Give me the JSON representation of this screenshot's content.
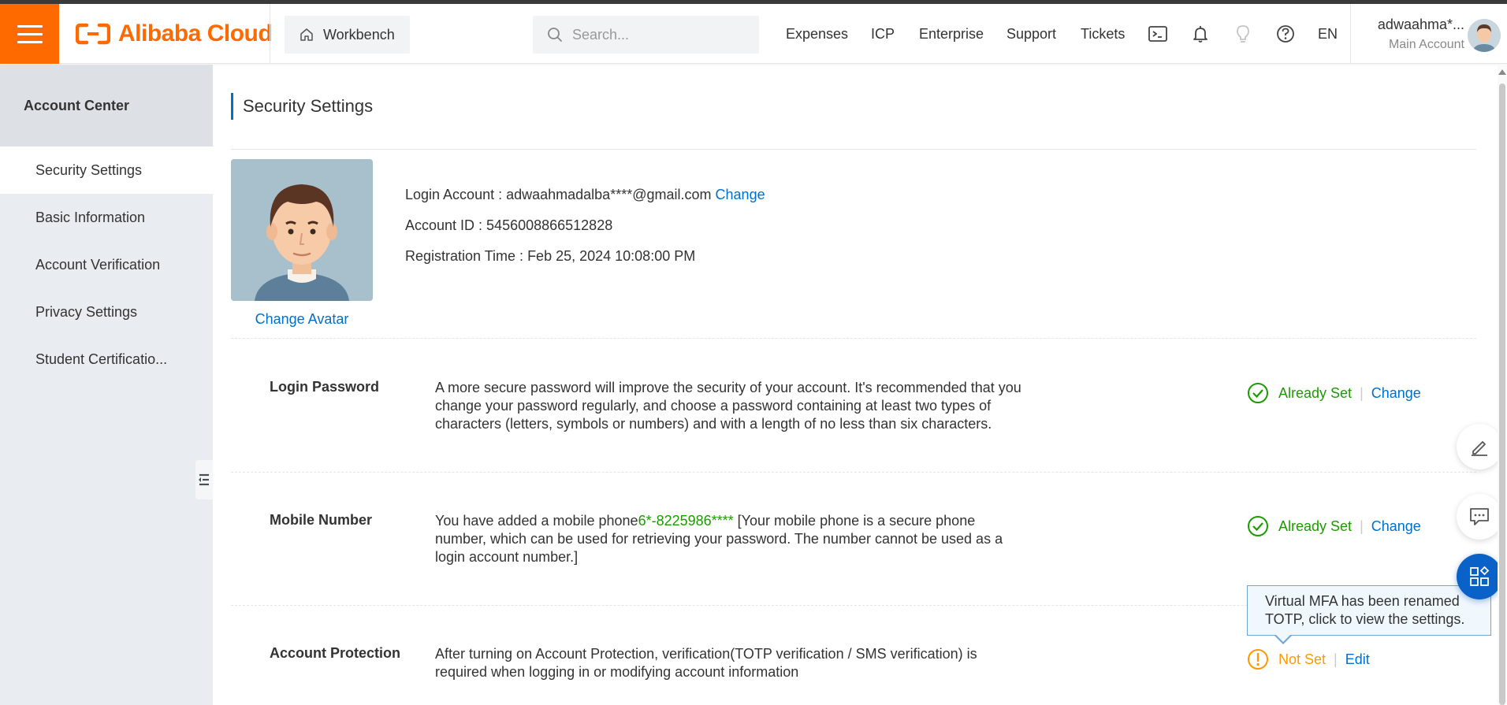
{
  "topbar": {
    "logo_text": "Alibaba Cloud",
    "workbench_label": "Workbench",
    "search_placeholder": "Search...",
    "nav": [
      "Expenses",
      "ICP",
      "Enterprise",
      "Support",
      "Tickets"
    ],
    "lang": "EN",
    "account_name": "adwaahma*...",
    "account_type": "Main Account"
  },
  "sidebar": {
    "title": "Account Center",
    "items": [
      {
        "label": "Security Settings",
        "active": true
      },
      {
        "label": "Basic Information",
        "active": false
      },
      {
        "label": "Account Verification",
        "active": false
      },
      {
        "label": "Privacy Settings",
        "active": false
      },
      {
        "label": "Student Certificatio...",
        "active": false
      }
    ]
  },
  "main": {
    "title": "Security Settings",
    "change_avatar": "Change Avatar",
    "login_account_label": "Login Account : ",
    "login_account_value": "adwaahmadalba****@gmail.com",
    "login_account_change": "Change",
    "account_id_label": "Account ID : ",
    "account_id_value": "5456008866512828",
    "registration_label": "Registration Time : ",
    "registration_value": "Feb 25, 2024 10:08:00 PM",
    "rows": [
      {
        "label": "Login Password",
        "desc": "A more secure password will improve the security of your account. It's recommended that you change your password regularly, and choose a password containing at least two types of characters (letters, symbols or numbers) and with a length of no less than six characters.",
        "status": "Already Set",
        "action": "Change"
      },
      {
        "label": "Mobile Number",
        "desc_prefix": "You have added a mobile phone",
        "desc_phone": "6*-8225986****",
        "desc_suffix": " [Your mobile phone is a secure phone number, which can be used for retrieving your password. The number cannot be used as a login account number.]",
        "status": "Already Set",
        "action": "Change"
      },
      {
        "label": "Account Protection",
        "desc": "After turning on Account Protection, verification(TOTP verification / SMS verification) is required when logging in or modifying account information",
        "status": "Not Set",
        "action": "Edit"
      }
    ],
    "tooltip": "Virtual MFA has been renamed TOTP, click to view the settings."
  },
  "colors": {
    "brand": "#ff6a00",
    "link": "#0070cc",
    "ok": "#1c9b00",
    "warn": "#ff9900"
  },
  "icons": [
    "menu-icon",
    "alibaba-logo-icon",
    "home-icon",
    "search-icon",
    "terminal-icon",
    "bell-icon",
    "lightbulb-icon",
    "help-icon",
    "check-circle-icon",
    "warning-circle-icon",
    "edit-icon",
    "chat-icon",
    "apps-icon",
    "collapse-icon"
  ]
}
